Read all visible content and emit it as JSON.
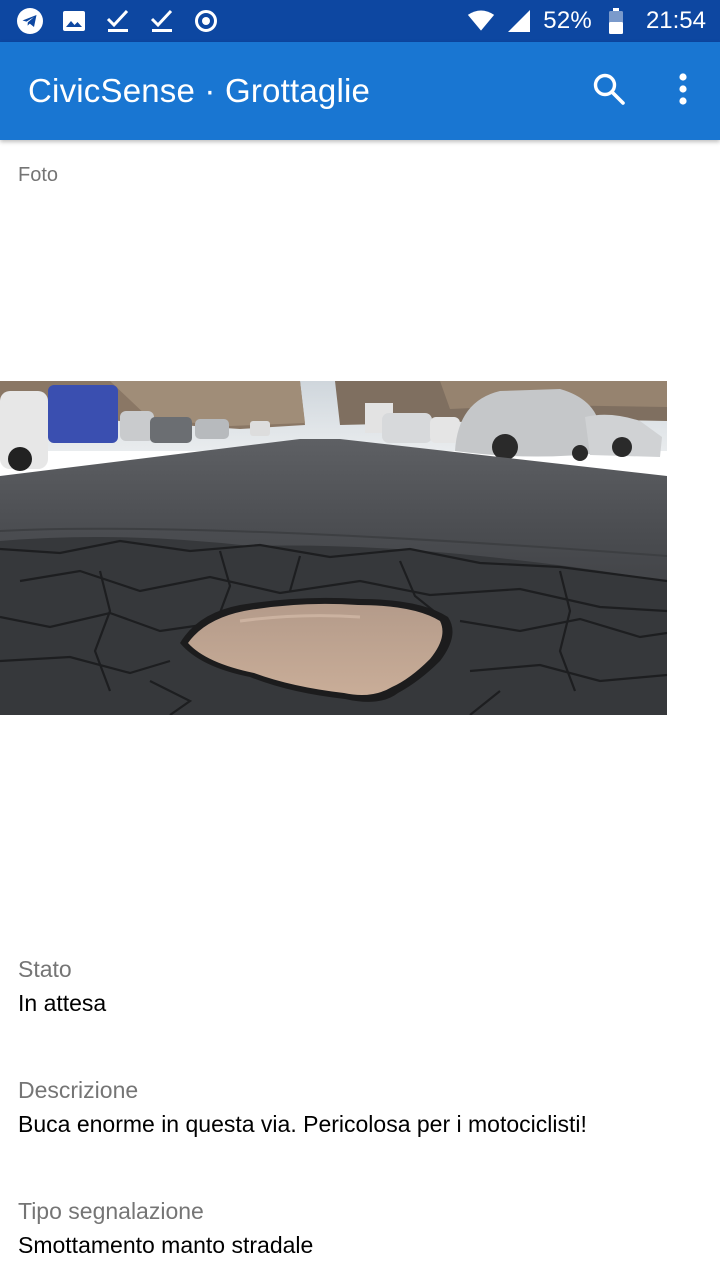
{
  "status_bar": {
    "battery": "52%",
    "time": "21:54",
    "icons": [
      "telegram-icon",
      "image-icon",
      "check-icon",
      "check-icon",
      "target-icon",
      "wifi-icon",
      "signal-icon",
      "battery-icon"
    ]
  },
  "app_bar": {
    "title": "CivicSense · Grottaglie",
    "actions": [
      "search-icon",
      "more-vert-icon"
    ]
  },
  "photo_section": {
    "label": "Foto"
  },
  "fields": {
    "stato": {
      "label": "Stato",
      "value": "In attesa"
    },
    "descrizione": {
      "label": "Descrizione",
      "value": "Buca enorme in questa via. Pericolosa per i motociclisti!"
    },
    "tipo": {
      "label": "Tipo segnalazione",
      "value": "Smottamento manto stradale"
    }
  },
  "colors": {
    "status_bar": "#0d47a1",
    "app_bar": "#1976d2",
    "label_gray": "#757575"
  }
}
